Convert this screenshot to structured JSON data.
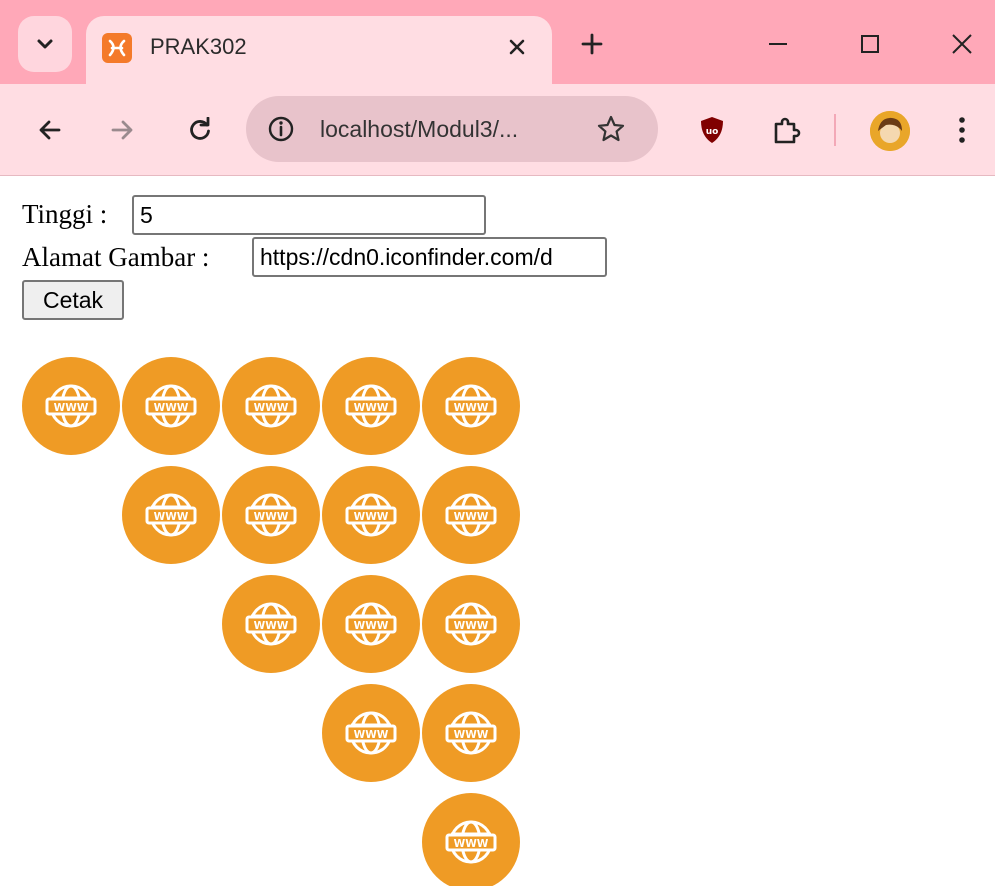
{
  "browser": {
    "tab_title": "PRAK302",
    "url": "localhost/Modul3/...",
    "colors": {
      "titlebar": "#ffa8b8",
      "toolbar": "#ffdde3",
      "favicon": "#f47a2a"
    },
    "icons": [
      "chevron-down-icon",
      "xampp-icon",
      "close-icon",
      "plus-icon",
      "minimize-icon",
      "maximize-icon",
      "close-icon",
      "back-icon",
      "forward-icon",
      "reload-icon",
      "info-icon",
      "star-icon",
      "ublock-icon",
      "puzzle-icon",
      "more-vert-icon"
    ]
  },
  "form": {
    "height_label": "Tinggi :",
    "height_value": "5",
    "image_label": "Alamat Gambar :",
    "image_value": "https://cdn0.iconfinder.com/d",
    "submit_label": "Cetak"
  },
  "output": {
    "rows": 5,
    "icon": "globe-www-icon",
    "icon_text": "WWW",
    "icon_color": "#ef9b25"
  }
}
